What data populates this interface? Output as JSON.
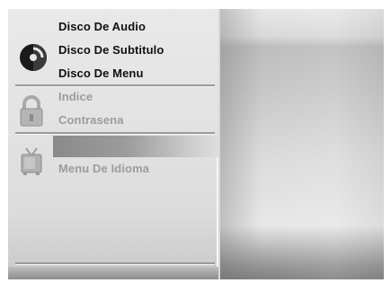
{
  "menu": {
    "disc_items": [
      {
        "label": "Disco De Audio"
      },
      {
        "label": "Disco De Subtitulo"
      },
      {
        "label": "Disco De Menu"
      }
    ],
    "lock_items": [
      {
        "label": "Indice"
      },
      {
        "label": "Contrasena"
      }
    ],
    "tv_items": [
      {
        "label": ""
      },
      {
        "label": "Menu De Idioma"
      }
    ]
  },
  "icons": {
    "disc": "disc-icon",
    "lock": "lock-icon",
    "tv": "tv-icon"
  },
  "colors": {
    "active_text": "#111111",
    "dim_text": "#9c9c9c",
    "highlight": "#8a8a8a"
  }
}
